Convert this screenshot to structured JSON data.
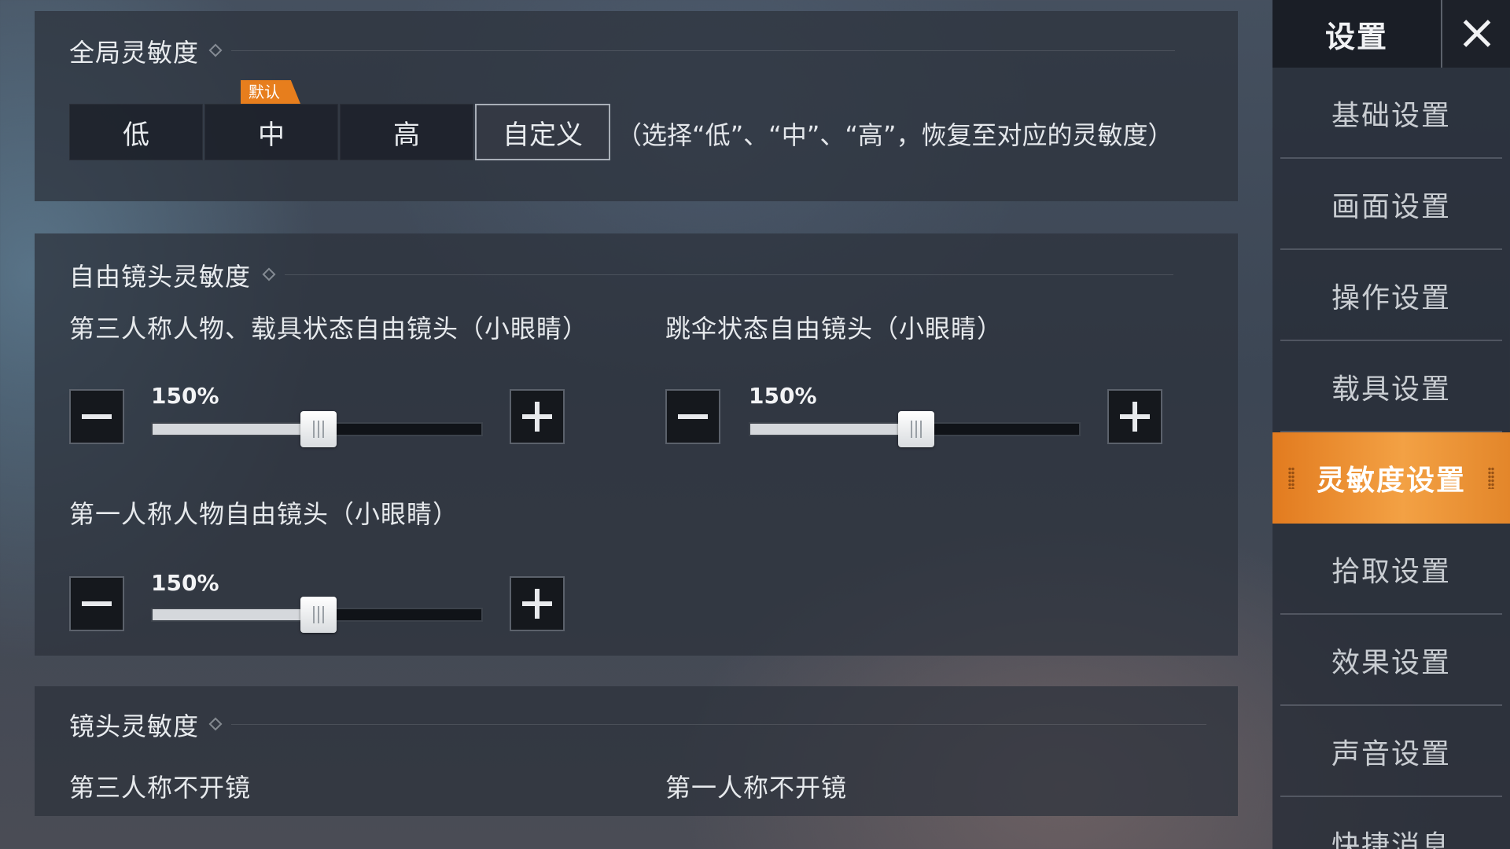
{
  "global_sensitivity": {
    "title": "全局灵敏度",
    "presets": [
      "低",
      "中",
      "高",
      "自定义"
    ],
    "active_preset": "自定义",
    "default_tag": "默认",
    "hint": "（选择“低”、“中”、“高”，恢复至对应的灵敏度）"
  },
  "free_look": {
    "title": "自由镜头灵敏度",
    "sliders": [
      {
        "label": "第三人称人物、载具状态自由镜头（小眼睛）",
        "value_text": "150%",
        "fraction": 0.5
      },
      {
        "label": "跳伞状态自由镜头（小眼睛）",
        "value_text": "150%",
        "fraction": 0.5
      },
      {
        "label": "第一人称人物自由镜头（小眼睛）",
        "value_text": "150%",
        "fraction": 0.5
      }
    ]
  },
  "scope": {
    "title": "镜头灵敏度",
    "labels": [
      "第三人称不开镜",
      "第一人称不开镜"
    ]
  },
  "sidebar": {
    "title": "设置",
    "items": [
      "基础设置",
      "画面设置",
      "操作设置",
      "载具设置",
      "灵敏度设置",
      "拾取设置",
      "效果设置",
      "声音设置",
      "快捷消息"
    ],
    "active": "灵敏度设置"
  },
  "colors": {
    "accent": "#e77e1d",
    "panel": "#2c323c"
  }
}
